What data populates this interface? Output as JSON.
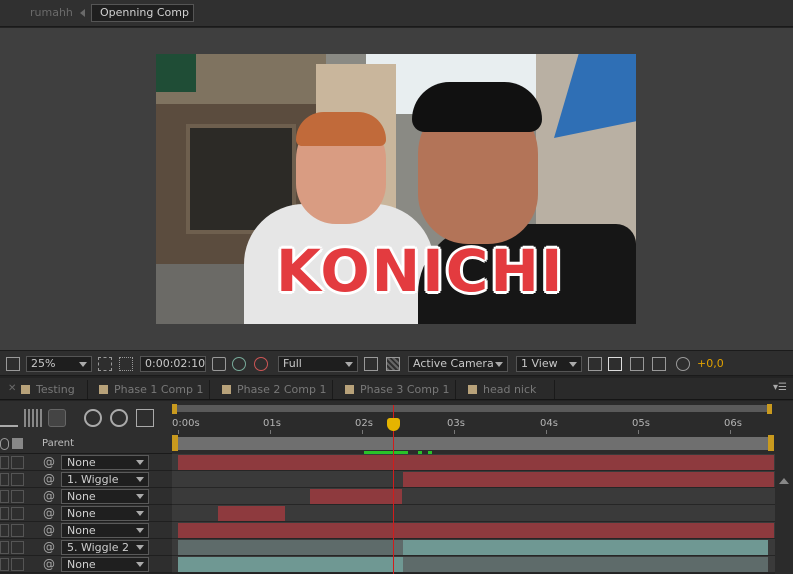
{
  "breadcrumb": {
    "root": "rumahh",
    "active": "Openning Comp"
  },
  "viewer": {
    "overlay_text": "KONICHI"
  },
  "viewer_bar": {
    "zoom": "25%",
    "timecode": "0:00:02:10",
    "resolution": "Full",
    "camera": "Active Camera",
    "views": "1 View",
    "exposure": "+0,0"
  },
  "tabs": [
    "Testing",
    "Phase 1 Comp 1",
    "Phase 2 Comp 1",
    "Phase 3 Comp 1",
    "head nick"
  ],
  "timeline": {
    "ticks": [
      "0:00s",
      "01s",
      "02s",
      "03s",
      "04s",
      "05s",
      "06s"
    ],
    "column_parent": "Parent",
    "layers": [
      {
        "parent": "None",
        "bar_color": "#8e3a3e"
      },
      {
        "parent": "1. Wiggle",
        "bar_color": "#8e3a3e"
      },
      {
        "parent": "None",
        "bar_color": "#8e3a3e"
      },
      {
        "parent": "None",
        "bar_color": "#8e3a3e"
      },
      {
        "parent": "None",
        "bar_color": "#8e3a3e"
      },
      {
        "parent": "5. Wiggle 2",
        "bar_color": "#6f9893"
      },
      {
        "parent": "None",
        "bar_color": "#6f9893"
      }
    ]
  },
  "colors": {
    "accent": "#e0a100",
    "playhead": "#d11c1c",
    "layer_red": "#8e3a3e",
    "layer_teal": "#6f9893"
  }
}
